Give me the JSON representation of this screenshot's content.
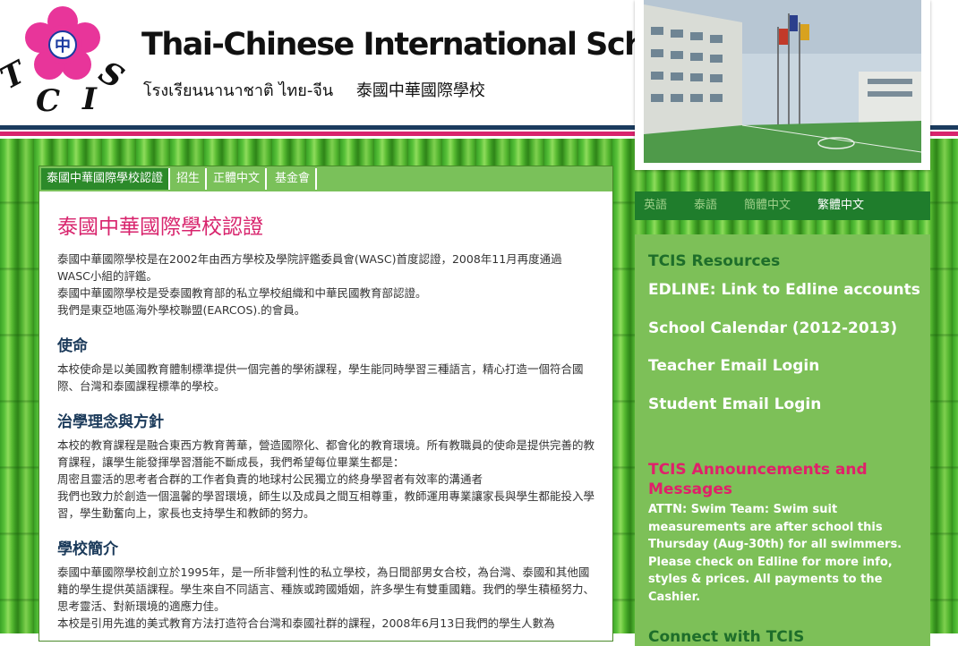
{
  "header": {
    "logo_letters": "TCIS",
    "logo_center": "中",
    "school_name": "Thai-Chinese International School",
    "name_thai": "โรงเรียนนานาชาติ ไทย-จีน",
    "name_chinese": "泰國中華國際學校"
  },
  "colors": {
    "accent_pink": "#d8246d",
    "nav_green": "#2c8a2a",
    "sidebar_green": "#7dc058",
    "heading_navy": "#1b3a5a"
  },
  "tabs": [
    {
      "label": "泰國中華國際學校認證",
      "active": true
    },
    {
      "label": "招生",
      "active": false
    },
    {
      "label": "正體中文",
      "active": false
    },
    {
      "label": "基金會",
      "active": false
    }
  ],
  "content": {
    "title": "泰國中華國際學校認證",
    "intro": [
      "泰國中華國際學校是在2002年由西方學校及學院評鑑委員會(WASC)首度認證，2008年11月再度通過WASC小組的評鑑。",
      "泰國中華國際學校是受泰國教育部的私立學校組織和中華民國教育部認證。",
      "我們是東亞地區海外學校聯盟(EARCOS).的會員。"
    ],
    "mission_head": "使命",
    "mission": "本校使命是以美國教育體制標準提供一個完善的學術課程，學生能同時學習三種語言，精心打造一個符合國際、台灣和泰國課程標準的學校。",
    "philosophy_head": "治學理念與方針",
    "philosophy": [
      "本校的教育課程是融合東西方教育菁華，營造國際化、都會化的教育環境。所有教職員的使命是提供完善的教育課程，讓學生能發揮學習潛能不斷成長，我們希望每位畢業生都是：",
      "周密且靈活的思考者合群的工作者負責的地球村公民獨立的終身學習者有效率的溝通者",
      "我們也致力於創造一個溫馨的學習環境，師生以及成員之間互相尊重，教師運用專業讓家長與學生都能投入學習，學生勤奮向上，家長也支持學生和教師的努力。"
    ],
    "profile_head": "學校簡介",
    "profile": [
      "泰國中華國際學校創立於1995年，是一所非營利性的私立學校，為日間部男女合校，為台灣、泰國和其他國籍的學生提供英語課程。學生來自不同語言、種族或跨國婚姻，許多學生有雙重國籍。我們的學生積極努力、思考靈活、對新環境的適應力佳。",
      "本校是引用先進的美式教育方法打造符合台灣和泰國社群的課程，2008年6月13日我們的學生人數為"
    ]
  },
  "languages": [
    {
      "label": "英語",
      "active": false
    },
    {
      "label": "泰語",
      "active": false
    },
    {
      "label": "簡體中文",
      "active": false
    },
    {
      "label": "繁體中文",
      "active": true
    }
  ],
  "sidebar": {
    "resources_head": "TCIS Resources",
    "links": [
      "EDLINE: Link to Edline accounts",
      "School Calendar (2012-2013)",
      "Teacher Email Login",
      "Student Email Login"
    ],
    "announcements_head": "TCIS Announcements and Messages",
    "announcement": "ATTN: Swim Team: Swim suit measurements are after school this Thursday (Aug-30th) for all swimmers. Please check on Edline for more info, styles & prices. All payments to the Cashier.",
    "next_head": "Connect with TCIS"
  }
}
